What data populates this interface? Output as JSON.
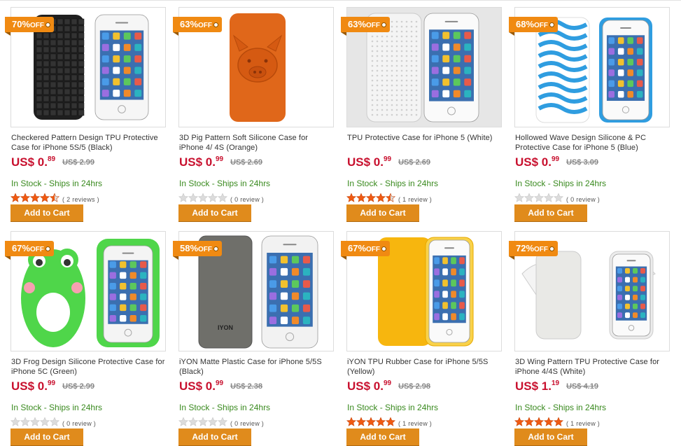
{
  "products": [
    {
      "discount": "70%",
      "off": "OFF",
      "title": "Checkered Pattern Design TPU Protective Case for iPhone 5S/5 (Black)",
      "price_main": "US$ 0.",
      "price_cents": "89",
      "old_price": "US$ 2.99",
      "stock": "In Stock - Ships in 24hrs",
      "rating": 4.5,
      "reviews": "( 2 reviews )",
      "cart": "Add to Cart",
      "case_color": "#1f1f1f"
    },
    {
      "discount": "63%",
      "off": "OFF",
      "title": "3D Pig Pattern Soft Silicone Case for iPhone 4/ 4S (Orange)",
      "price_main": "US$ 0.",
      "price_cents": "99",
      "old_price": "US$ 2.69",
      "stock": "In Stock - Ships in 24hrs",
      "rating": 0,
      "reviews": "( 0 review )",
      "cart": "Add to Cart",
      "case_color": "#e0671a"
    },
    {
      "discount": "63%",
      "off": "OFF",
      "title": "TPU Protective Case for iPhone 5 (White)",
      "price_main": "US$ 0.",
      "price_cents": "99",
      "old_price": "US$ 2.69",
      "stock": "In Stock - Ships in 24hrs",
      "rating": 4.5,
      "reviews": "( 1 review )",
      "cart": "Add to Cart",
      "case_color": "#f4f4f4"
    },
    {
      "discount": "68%",
      "off": "OFF",
      "title": "Hollowed Wave Design Silicone & PC Protective Case for iPhone 5 (Blue)",
      "price_main": "US$ 0.",
      "price_cents": "99",
      "old_price": "US$ 3.09",
      "stock": "In Stock - Ships in 24hrs",
      "rating": 0,
      "reviews": "( 0 review )",
      "cart": "Add to Cart",
      "case_color": "#2f9de0"
    },
    {
      "discount": "67%",
      "off": "OFF",
      "title": "3D Frog Design Silicone Protective Case for iPhone 5C (Green)",
      "price_main": "US$ 0.",
      "price_cents": "99",
      "old_price": "US$ 2.99",
      "stock": "In Stock - Ships in 24hrs",
      "rating": 0,
      "reviews": "( 0 review )",
      "cart": "Add to Cart",
      "case_color": "#4fd64a"
    },
    {
      "discount": "58%",
      "off": "OFF",
      "title": "iYON Matte Plastic Case for iPhone 5/5S (Black)",
      "price_main": "US$ 0.",
      "price_cents": "99",
      "old_price": "US$ 2.38",
      "stock": "In Stock - Ships in 24hrs",
      "rating": 0,
      "reviews": "( 0 review )",
      "cart": "Add to Cart",
      "case_color": "#6f6f6a",
      "brand": "IYON"
    },
    {
      "discount": "67%",
      "off": "OFF",
      "title": "iYON TPU Rubber Case for iPhone 5/5S (Yellow)",
      "price_main": "US$ 0.",
      "price_cents": "99",
      "old_price": "US$ 2.98",
      "stock": "In Stock - Ships in 24hrs",
      "rating": 5,
      "reviews": "( 1 review )",
      "cart": "Add to Cart",
      "case_color": "#f7b60e"
    },
    {
      "discount": "72%",
      "off": "OFF",
      "title": "3D Wing Pattern TPU Protective Case for iPhone 4/4S (White)",
      "price_main": "US$ 1.",
      "price_cents": "19",
      "old_price": "US$ 4.19",
      "stock": "In Stock - Ships in 24hrs",
      "rating": 5,
      "reviews": "( 1 review )",
      "cart": "Add to Cart",
      "case_color": "#e9e9e6"
    }
  ]
}
